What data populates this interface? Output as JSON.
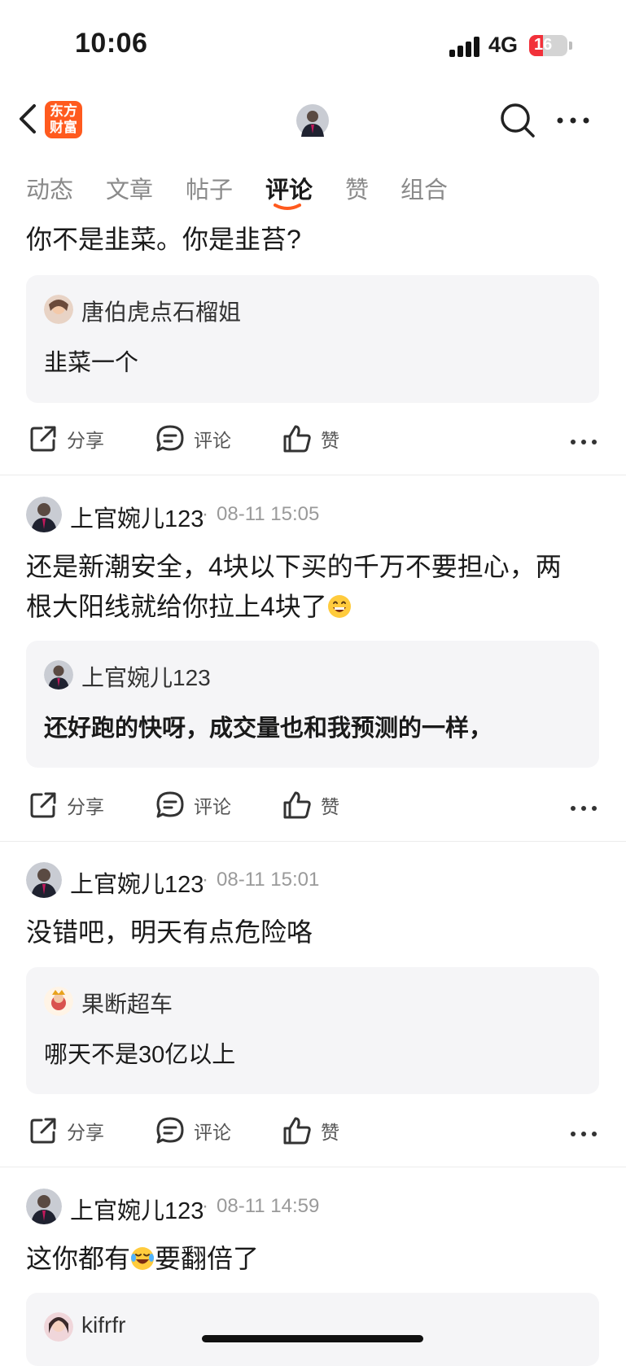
{
  "status_bar": {
    "time": "10:06",
    "network": "4G",
    "battery": "16",
    "battery_fraction": 0.16
  },
  "nav": {
    "logo_text": "东方财富"
  },
  "tabs": [
    {
      "label": "动态",
      "active": false
    },
    {
      "label": "文章",
      "active": false
    },
    {
      "label": "帖子",
      "active": false
    },
    {
      "label": "评论",
      "active": true
    },
    {
      "label": "赞",
      "active": false
    },
    {
      "label": "组合",
      "active": false
    }
  ],
  "actions": {
    "share": "分享",
    "comment": "评论",
    "like": "赞"
  },
  "items": [
    {
      "text": "你不是韭菜。你是韭苔?",
      "quote": {
        "user": "唐伯虎点石榴姐",
        "text": "韭菜一个"
      }
    },
    {
      "user": "上官婉儿123",
      "time": "08-11 15:05",
      "text_line1": "还是新潮安全，4块以下买的千万不要担心，两",
      "text_line2": "根大阳线就给你拉上4块了",
      "quote": {
        "user": "上官婉儿123",
        "text": "还好跑的快呀，成交量也和我预测的一样，"
      }
    },
    {
      "user": "上官婉儿123",
      "time": "08-11 15:01",
      "text": "没错吧，明天有点危险咯",
      "quote": {
        "user": "果断超车",
        "text": "哪天不是30亿以上"
      }
    },
    {
      "user": "上官婉儿123",
      "time": "08-11 14:59",
      "text_before": "这你都有",
      "text_after": "要翻倍了",
      "quote": {
        "user": "kifrfr"
      }
    }
  ],
  "meta_separator": "·",
  "colors": {
    "accent": "#ff5a1e",
    "battery_low": "#f2313a",
    "quote_bg": "#f5f5f7"
  },
  "icons": [
    "back-icon",
    "search-icon",
    "more-icon",
    "share-icon",
    "comment-icon",
    "like-icon"
  ]
}
